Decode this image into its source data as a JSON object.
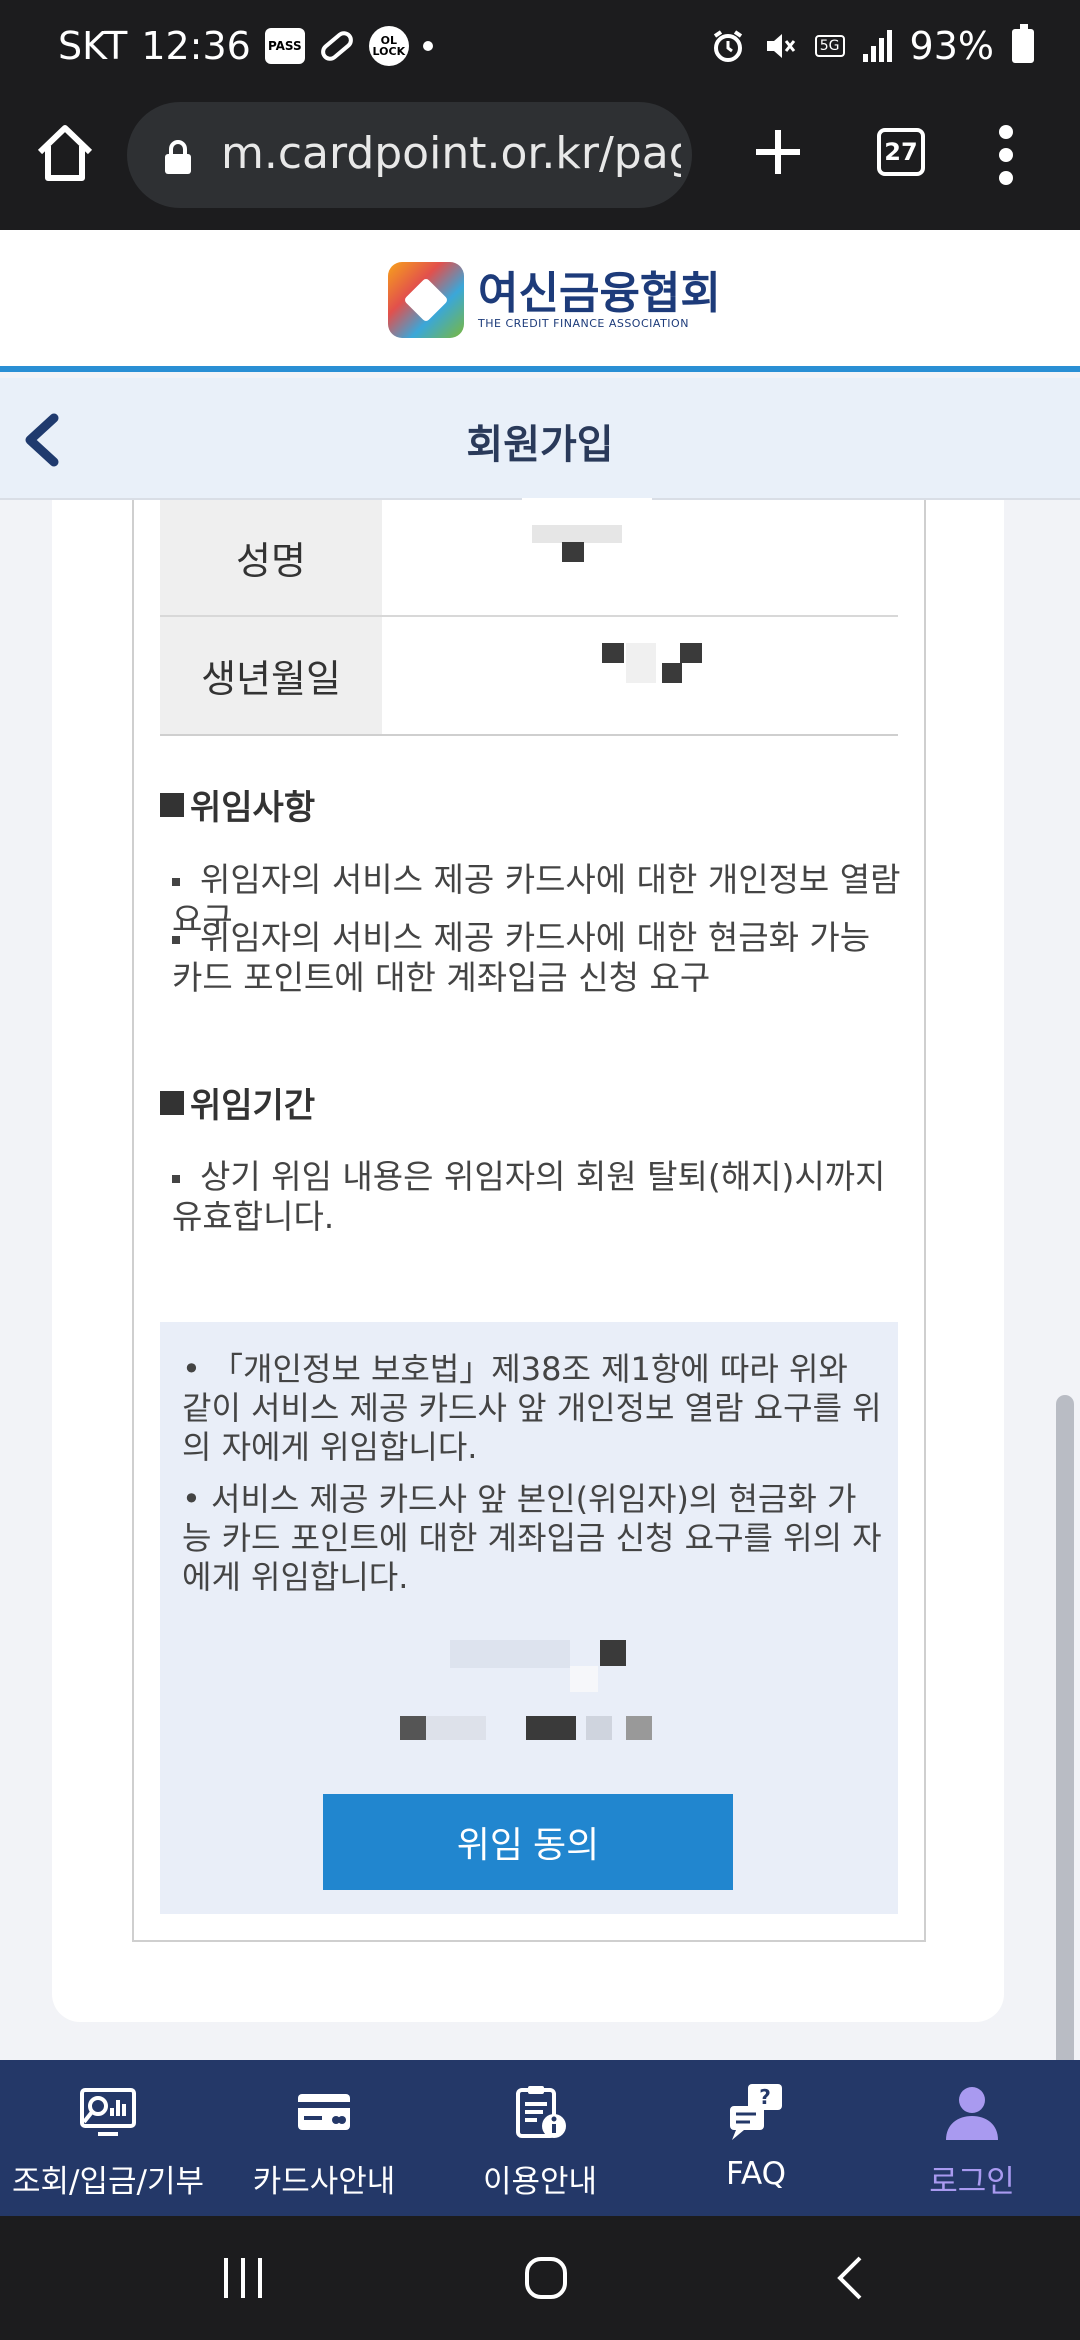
{
  "status": {
    "carrier": "SKT",
    "time": "12:36",
    "battery": "93%",
    "network": "5G"
  },
  "browser": {
    "url": "m.cardpoint.or.kr/page",
    "tab_count": "27"
  },
  "site": {
    "logo_kr": "여신금융협회",
    "logo_en": "THE CREDIT FINANCE ASSOCIATION"
  },
  "page": {
    "title": "회원가입"
  },
  "info": {
    "name_label": "성명",
    "birth_label": "생년월일"
  },
  "delegation": {
    "title": "위임사항",
    "items": [
      "위임자의 서비스 제공 카드사에 대한 개인정보 열람 요구",
      "위임자의 서비스 제공 카드사에 대한 현금화 가능 카드 포인트에 대한 계좌입금 신청 요구"
    ]
  },
  "period": {
    "title": "위임기간",
    "items": [
      "상기 위임 내용은 위임자의 회원 탈퇴(해지)시까지 유효합니다."
    ]
  },
  "notice": {
    "items": [
      "「개인정보 보호법」제38조 제1항에 따라 위와 같이 서비스 제공 카드사 앞 개인정보 열람 요구를 위의 자에게 위임합니다.",
      "서비스 제공 카드사 앞 본인(위임자)의 현금화 가능 카드 포인트에 대한 계좌입금 신청 요구를 위의 자에게 위임합니다."
    ],
    "agree_label": "위임 동의"
  },
  "bottom_nav": [
    {
      "label": "조회/입금/기부",
      "icon": "search-chart-icon"
    },
    {
      "label": "카드사안내",
      "icon": "card-icon"
    },
    {
      "label": "이용안내",
      "icon": "clipboard-info-icon"
    },
    {
      "label": "FAQ",
      "icon": "faq-chat-icon"
    },
    {
      "label": "로그인",
      "icon": "user-icon",
      "active": true
    }
  ],
  "colors": {
    "brand_blue": "#2186cf",
    "nav_bg": "#243868",
    "active_nav": "#a99af0",
    "header_line": "#2a8fd4"
  }
}
